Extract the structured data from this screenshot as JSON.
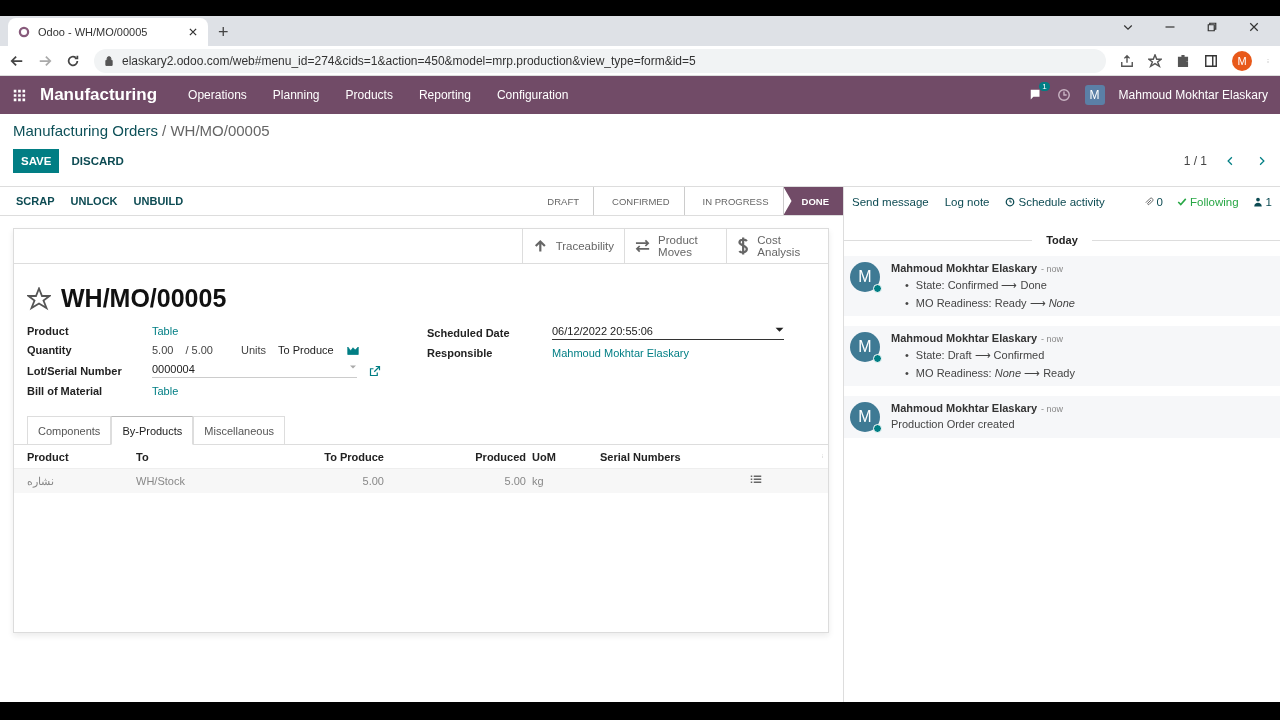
{
  "browser": {
    "tab_title": "Odoo - WH/MO/00005",
    "new_tab": "+",
    "url": "elaskary2.odoo.com/web#menu_id=274&cids=1&action=450&model=mrp.production&view_type=form&id=5",
    "profile_letter": "M"
  },
  "navbar": {
    "app": "Manufacturing",
    "menus": [
      "Operations",
      "Planning",
      "Products",
      "Reporting",
      "Configuration"
    ],
    "messages_count": "1",
    "user_letter": "M",
    "user": "Mahmoud Mokhtar Elaskary"
  },
  "breadcrumb": {
    "parent": "Manufacturing Orders",
    "current": "/ WH/MO/00005"
  },
  "buttons": [
    {
      "label": "SAVE",
      "kind": "primary"
    },
    {
      "label": "DISCARD",
      "kind": "link"
    }
  ],
  "pager": "1 / 1",
  "actions": [
    "SCRAP",
    "UNLOCK",
    "UNBUILD"
  ],
  "stages": [
    {
      "label": "DRAFT",
      "selected": false
    },
    {
      "label": "CONFIRMED",
      "selected": false
    },
    {
      "label": "IN PROGRESS",
      "selected": false
    },
    {
      "label": "DONE",
      "selected": true
    }
  ],
  "smart_buttons": [
    {
      "label": "Traceability",
      "kind": "up"
    },
    {
      "label": "Product Moves",
      "kind": "swap"
    },
    {
      "label": "Cost Analysis",
      "kind": "dollar"
    }
  ],
  "record": {
    "starred": false,
    "name": "WH/MO/00005"
  },
  "left_fields": [
    {
      "label": "Product",
      "kind": "link",
      "value": "Table"
    },
    {
      "label": "Quantity",
      "kind": "quantity",
      "value": "5.00",
      "total": "/ 5.00",
      "unit": "Units",
      "note": "To Produce"
    },
    {
      "label": "Lot/Serial Number",
      "kind": "select",
      "value": "0000004"
    },
    {
      "label": "Bill of Material",
      "kind": "link",
      "value": "Table"
    }
  ],
  "right_fields": [
    {
      "label": "Scheduled Date",
      "kind": "date",
      "value": "06/12/2022 20:55:06"
    },
    {
      "label": "Responsible",
      "kind": "link",
      "value": "Mahmoud Mokhtar Elaskary"
    }
  ],
  "tabs": [
    {
      "label": "Components",
      "selected": false
    },
    {
      "label": "By-Products",
      "selected": true
    },
    {
      "label": "Miscellaneous",
      "selected": false
    }
  ],
  "table": {
    "columns": [
      "Product",
      "To",
      "To Produce",
      "Produced",
      "UoM",
      "Serial Numbers"
    ],
    "rows": [
      {
        "cells": [
          "نشاره",
          "WH/Stock",
          "5.00",
          "5.00",
          "kg"
        ]
      }
    ]
  },
  "chatter": {
    "actions": [
      "Send message",
      "Log note",
      "Schedule activity"
    ],
    "attachments": "0",
    "following": "Following",
    "bullet": "•",
    "followers": "1",
    "date": "Today",
    "messages": [
      {
        "avatar": "M",
        "author": "Mahmoud Mokhtar Elaskary",
        "time": "- now",
        "kind": "tracking",
        "lines": [
          "State: Confirmed ⟶ Done",
          "MO Readiness: Ready ⟶ *None*"
        ]
      },
      {
        "avatar": "M",
        "author": "Mahmoud Mokhtar Elaskary",
        "time": "- now",
        "kind": "tracking",
        "lines": [
          "State: Draft ⟶ Confirmed",
          "MO Readiness: *None*  ⟶ Ready"
        ]
      },
      {
        "avatar": "M",
        "author": "Mahmoud Mokhtar Elaskary",
        "time": "- now",
        "kind": "text",
        "lines": [
          "Production Order created"
        ]
      }
    ]
  }
}
